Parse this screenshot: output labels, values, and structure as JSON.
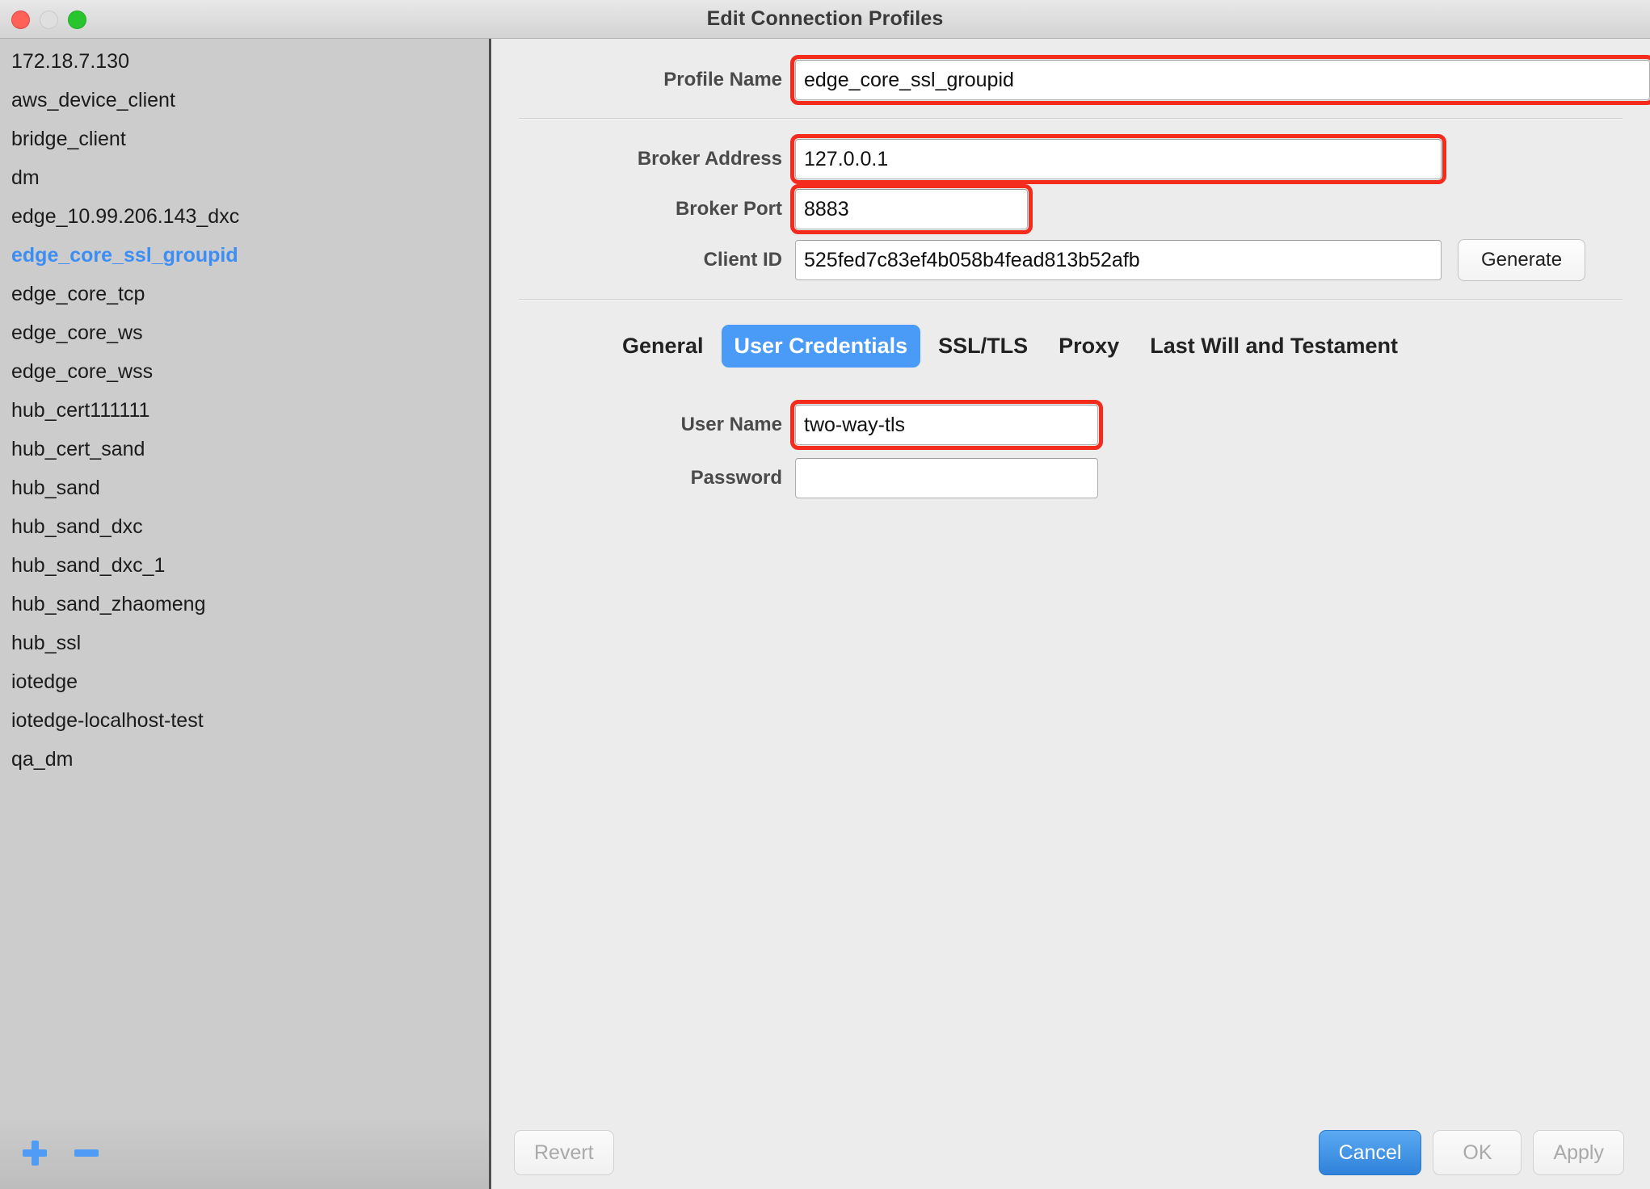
{
  "window": {
    "title": "Edit Connection Profiles",
    "traffic_lights": [
      "close",
      "minimize",
      "maximize"
    ]
  },
  "sidebar": {
    "profiles": [
      {
        "name": "172.18.7.130",
        "selected": false
      },
      {
        "name": "aws_device_client",
        "selected": false
      },
      {
        "name": "bridge_client",
        "selected": false
      },
      {
        "name": "dm",
        "selected": false
      },
      {
        "name": "edge_10.99.206.143_dxc",
        "selected": false
      },
      {
        "name": "edge_core_ssl_groupid",
        "selected": true
      },
      {
        "name": "edge_core_tcp",
        "selected": false
      },
      {
        "name": "edge_core_ws",
        "selected": false
      },
      {
        "name": "edge_core_wss",
        "selected": false
      },
      {
        "name": "hub_cert111111",
        "selected": false
      },
      {
        "name": "hub_cert_sand",
        "selected": false
      },
      {
        "name": "hub_sand",
        "selected": false
      },
      {
        "name": "hub_sand_dxc",
        "selected": false
      },
      {
        "name": "hub_sand_dxc_1",
        "selected": false
      },
      {
        "name": "hub_sand_zhaomeng",
        "selected": false
      },
      {
        "name": "hub_ssl",
        "selected": false
      },
      {
        "name": "iotedge",
        "selected": false
      },
      {
        "name": "iotedge-localhost-test",
        "selected": false
      },
      {
        "name": "qa_dm",
        "selected": false
      }
    ],
    "add_label": "+",
    "remove_label": "−"
  },
  "form": {
    "profile_name": {
      "label": "Profile Name",
      "value": "edge_core_ssl_groupid",
      "placeholder": "",
      "highlighted": true
    },
    "broker_address": {
      "label": "Broker Address",
      "value": "127.0.0.1",
      "placeholder": "",
      "highlighted": true
    },
    "broker_port": {
      "label": "Broker Port",
      "value": "8883",
      "placeholder": "",
      "highlighted": true
    },
    "client_id": {
      "label": "Client ID",
      "value": "525fed7c83ef4b058b4fead813b52afb",
      "placeholder": "",
      "highlighted": false
    },
    "generate_label": "Generate"
  },
  "tabs": [
    {
      "label": "General",
      "active": false
    },
    {
      "label": "User Credentials",
      "active": true
    },
    {
      "label": "SSL/TLS",
      "active": false
    },
    {
      "label": "Proxy",
      "active": false
    },
    {
      "label": "Last Will and Testament",
      "active": false
    }
  ],
  "credentials": {
    "user_name": {
      "label": "User Name",
      "value": "two-way-tls",
      "placeholder": "",
      "highlighted": true
    },
    "password": {
      "label": "Password",
      "value": "",
      "placeholder": "",
      "highlighted": false
    }
  },
  "footer": {
    "revert_label": "Revert",
    "cancel_label": "Cancel",
    "ok_label": "OK",
    "apply_label": "Apply"
  },
  "colors": {
    "accent_blue": "#4a9bf7",
    "primary_button": "#2f82da",
    "highlight_red": "#f32c1e",
    "selected_text": "#3c8ef5",
    "sidebar_bg": "#cccccc",
    "panel_bg": "#ececec"
  }
}
